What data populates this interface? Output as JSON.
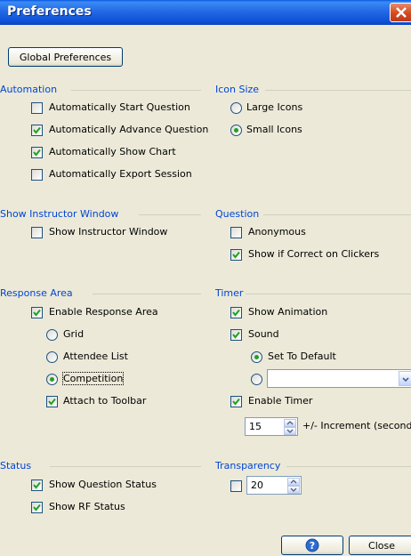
{
  "window": {
    "title": "Preferences"
  },
  "buttons": {
    "global": "Global Preferences",
    "close": "Close"
  },
  "groups": {
    "automation": {
      "title": "Automation",
      "items": [
        {
          "label": "Automatically Start Question",
          "checked": false
        },
        {
          "label": "Automatically Advance Question",
          "checked": true
        },
        {
          "label": "Automatically Show Chart",
          "checked": true
        },
        {
          "label": "Automatically Export Session",
          "checked": false
        }
      ]
    },
    "icon_size": {
      "title": "Icon Size",
      "options": [
        {
          "label": "Large Icons",
          "selected": false
        },
        {
          "label": "Small Icons",
          "selected": true
        }
      ]
    },
    "instructor": {
      "title": "Show Instructor Window",
      "items": [
        {
          "label": "Show Instructor Window",
          "checked": false
        }
      ]
    },
    "question": {
      "title": "Question",
      "items": [
        {
          "label": "Anonymous",
          "checked": false
        },
        {
          "label": "Show if Correct on Clickers",
          "checked": true
        }
      ]
    },
    "response": {
      "title": "Response Area",
      "enable": {
        "label": "Enable Response Area",
        "checked": true
      },
      "options": [
        {
          "label": "Grid",
          "selected": false
        },
        {
          "label": "Attendee List",
          "selected": false
        },
        {
          "label": "Competition",
          "selected": true
        }
      ],
      "attach": {
        "label": "Attach to Toolbar",
        "checked": true
      }
    },
    "timer": {
      "title": "Timer",
      "show_animation": {
        "label": "Show Animation",
        "checked": true
      },
      "sound": {
        "label": "Sound",
        "checked": true
      },
      "sound_options": [
        {
          "label": "Set To Default",
          "selected": true
        },
        {
          "label": "",
          "selected": false
        }
      ],
      "enable_timer": {
        "label": "Enable Timer",
        "checked": true
      },
      "increment_value": "15",
      "increment_label": "+/- Increment (seconds)"
    },
    "status": {
      "title": "Status",
      "items": [
        {
          "label": "Show Question Status",
          "checked": true
        },
        {
          "label": "Show RF Status",
          "checked": true
        }
      ]
    },
    "transparency": {
      "title": "Transparency",
      "checked": false,
      "value": "20"
    }
  },
  "colors": {
    "group_title": "#0046d5",
    "titlebar": "#0a58e0",
    "check": "#21a121",
    "dialog_bg": "#ece9d8"
  },
  "icons": {
    "help": "help-icon",
    "close": "close-icon"
  }
}
